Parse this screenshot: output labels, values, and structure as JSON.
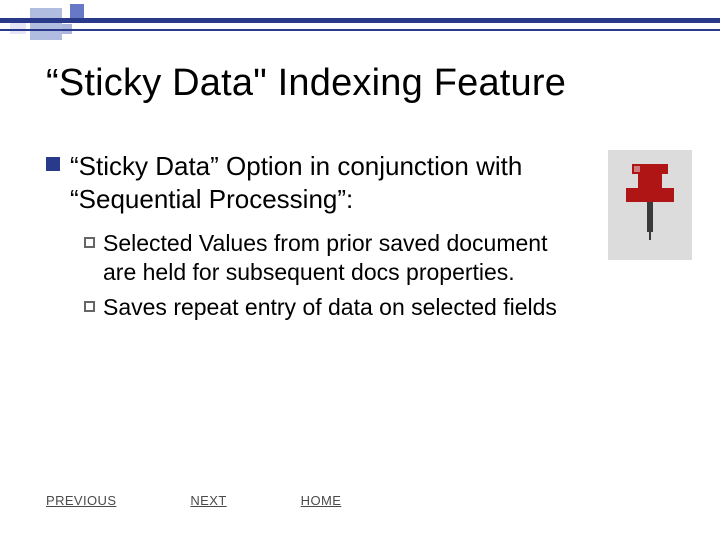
{
  "slide": {
    "title": "“Sticky Data\" Indexing Feature"
  },
  "bullets": {
    "lvl1": "“Sticky Data” Option in conjunction with “Sequential Processing”:",
    "lvl2a": "Selected Values from prior saved document are held for subsequent docs properties.",
    "lvl2b": "Saves repeat entry of data on selected fields"
  },
  "nav": {
    "previous": "PREVIOUS",
    "next": "NEXT",
    "home": "HOME"
  },
  "icons": {
    "pushpin": "pushpin-icon"
  }
}
